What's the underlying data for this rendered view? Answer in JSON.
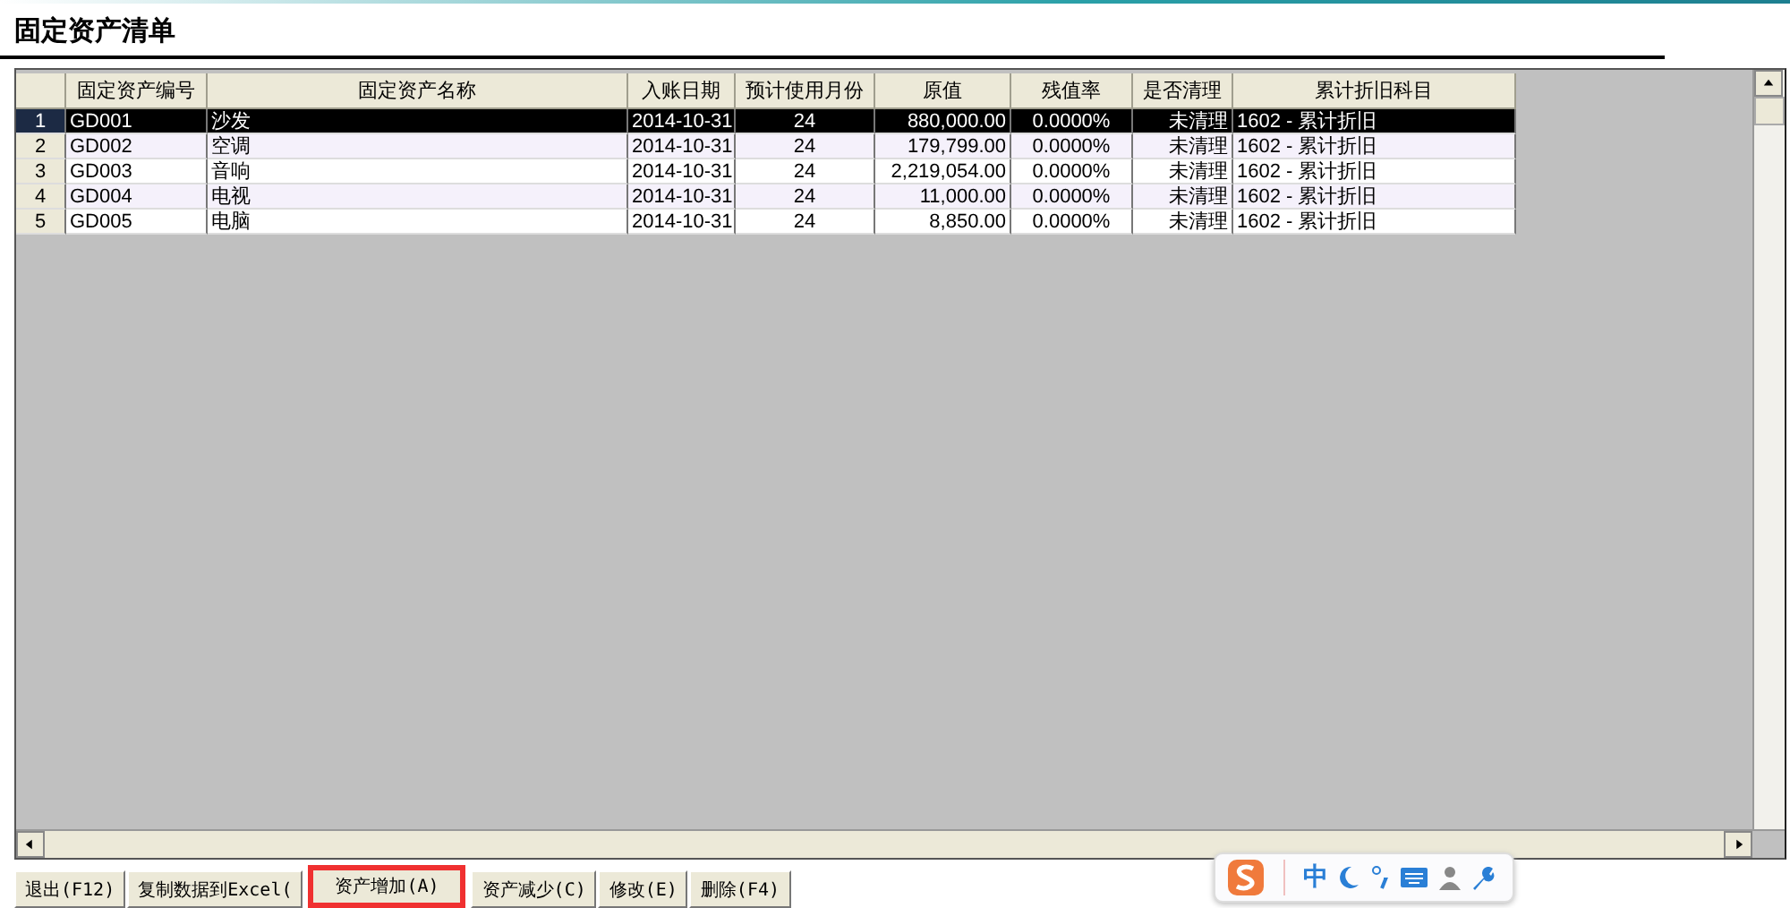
{
  "title": "固定资产清单",
  "table": {
    "columns": [
      {},
      {
        "label": "固定资产编号"
      },
      {
        "label": "固定资产名称"
      },
      {
        "label": "入账日期"
      },
      {
        "label": "预计使用月份"
      },
      {
        "label": "原值"
      },
      {
        "label": "残值率"
      },
      {
        "label": "是否清理"
      },
      {
        "label": "累计折旧科目"
      }
    ],
    "rows": [
      {
        "selected": true,
        "cells": [
          "1",
          "GD001",
          "沙发",
          "2014-10-31",
          "24",
          "880,000.00",
          "0.0000%",
          "未清理",
          "1602 - 累计折旧"
        ]
      },
      {
        "selected": false,
        "cells": [
          "2",
          "GD002",
          "空调",
          "2014-10-31",
          "24",
          "179,799.00",
          "0.0000%",
          "未清理",
          "1602 - 累计折旧"
        ]
      },
      {
        "selected": false,
        "cells": [
          "3",
          "GD003",
          "音响",
          "2014-10-31",
          "24",
          "2,219,054.00",
          "0.0000%",
          "未清理",
          "1602 - 累计折旧"
        ]
      },
      {
        "selected": false,
        "cells": [
          "4",
          "GD004",
          "电视",
          "2014-10-31",
          "24",
          "11,000.00",
          "0.0000%",
          "未清理",
          "1602 - 累计折旧"
        ]
      },
      {
        "selected": false,
        "cells": [
          "5",
          "GD005",
          "电脑",
          "2014-10-31",
          "24",
          "8,850.00",
          "0.0000%",
          "未清理",
          "1602 - 累计折旧"
        ]
      }
    ]
  },
  "buttons": [
    {
      "label": "退出(F12)",
      "highlighted": false
    },
    {
      "label": "复制数据到Excel(",
      "highlighted": false
    },
    {
      "label": "资产增加(A)",
      "highlighted": true
    },
    {
      "label": "资产减少(C)",
      "highlighted": false
    },
    {
      "label": "修改(E)",
      "highlighted": false
    },
    {
      "label": "删除(F4)",
      "highlighted": false
    }
  ],
  "ime_toolbar": {
    "mode": "中"
  }
}
